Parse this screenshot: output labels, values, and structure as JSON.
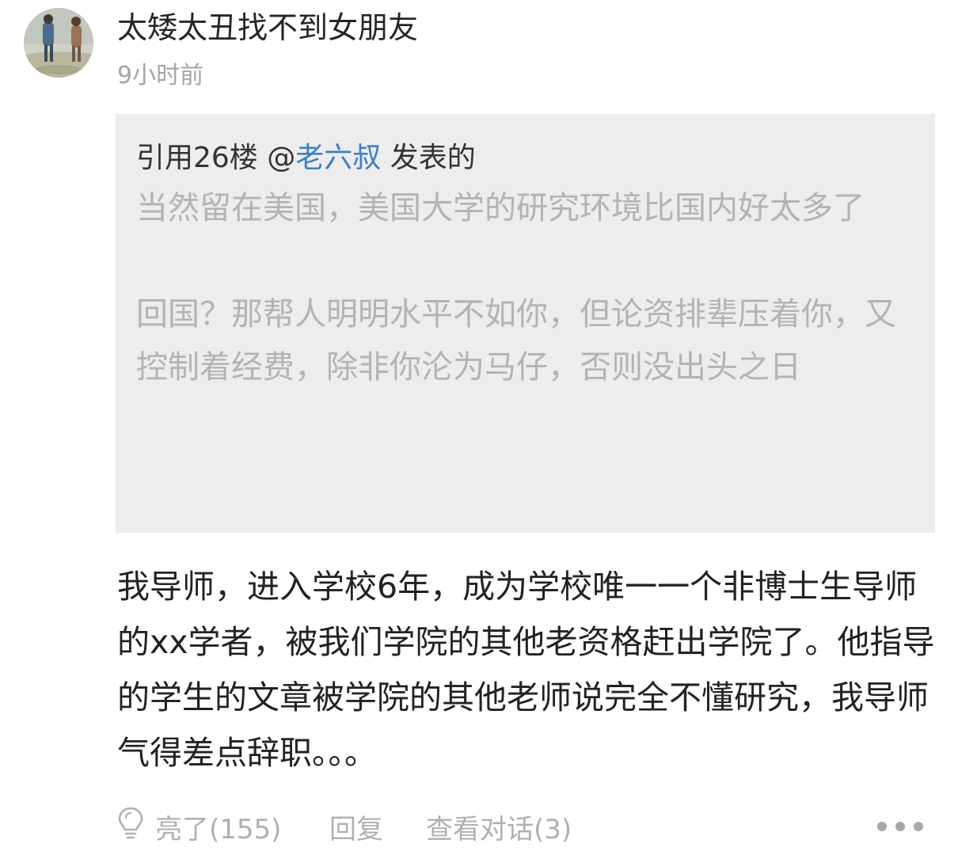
{
  "post": {
    "username": "太矮太丑找不到女朋友",
    "time": "9小时前",
    "quote": {
      "prefix": "引用26楼 @",
      "mention": "老六叔",
      "suffix": " 发表的",
      "paragraph_1": "当然留在美国，美国大学的研究环境比国内好太多了",
      "paragraph_2": "回国？那帮人明明水平不如你，但论资排辈压着你，又控制着经费，除非你沦为马仔，否则没出头之日"
    },
    "body": "我导师，进入学校6年，成为学校唯一一个非博士生导师的xx学者，被我们学院的其他老资格赶出学院了。他指导的学生的文章被学院的其他老师说完全不懂研究，我导师气得差点辞职。。。",
    "actions": {
      "like_label": "亮了(155)",
      "reply_label": "回复",
      "view_conversation_label": "查看对话(3)",
      "more_icon": "more-dots-icon",
      "like_icon": "lightbulb-icon"
    }
  },
  "colors": {
    "mention": "#3b7fc4",
    "quote_background": "#eeeced",
    "muted_text": "#b0b0b0"
  }
}
